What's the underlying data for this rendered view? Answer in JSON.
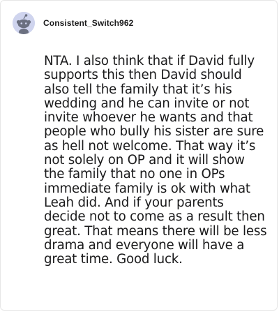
{
  "comment": {
    "author": "Consistent_Switch962",
    "avatar_icon": "snoo-avatar-icon",
    "body": "NTA. I also think that if David fully supports this then David should also tell the family that it’s his wedding and he can invite or not invite whoever he wants and that people who bully his sister are sure as hell not welcome. That way it’s not solely on OP and it will show the family that no one in OPs immediate family is ok with what Leah did. And if your parents decide not to come as a result then great. That means there will be less drama and everyone will have a great time. Good luck."
  },
  "colors": {
    "avatar_bg": "#cfd4ee",
    "text": "#1a1a1b",
    "border": "#e6e6e6"
  }
}
